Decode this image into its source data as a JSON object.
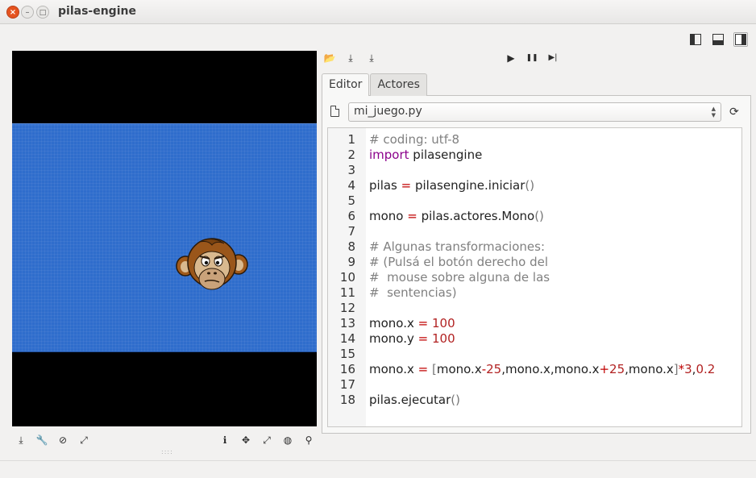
{
  "window": {
    "title": "pilas-engine",
    "close_glyph": "×",
    "min_glyph": "–",
    "max_glyph": "□"
  },
  "layout_buttons": [
    {
      "icon": "layout-left-panel-icon"
    },
    {
      "icon": "layout-bottom-panel-icon"
    },
    {
      "icon": "layout-right-panel-icon",
      "active": true
    }
  ],
  "editor_toolbar": {
    "file_actions": [
      {
        "icon": "open-folder-icon",
        "glyph": "📂"
      },
      {
        "icon": "save-icon",
        "glyph": "⤓"
      },
      {
        "icon": "save-as-icon",
        "glyph": "⤓"
      }
    ],
    "run_actions": [
      {
        "icon": "play-icon",
        "glyph": "▶"
      },
      {
        "icon": "pause-icon",
        "glyph": "❚❚"
      },
      {
        "icon": "step-icon",
        "glyph": "▶|"
      }
    ]
  },
  "tabs": [
    {
      "label": "Editor",
      "active": true
    },
    {
      "label": "Actores",
      "active": false
    }
  ],
  "file_selector": {
    "value": "mi_juego.py"
  },
  "code": {
    "lines": [
      {
        "n": "1",
        "tokens": [
          {
            "t": "# coding: utf-8",
            "c": "cm"
          }
        ]
      },
      {
        "n": "2",
        "tokens": [
          {
            "t": "import",
            "c": "kw"
          },
          {
            "t": " pilasengine",
            "c": ""
          }
        ]
      },
      {
        "n": "3",
        "tokens": []
      },
      {
        "n": "4",
        "tokens": [
          {
            "t": "pilas ",
            "c": ""
          },
          {
            "t": "=",
            "c": "op"
          },
          {
            "t": " pilasengine.iniciar",
            "c": ""
          },
          {
            "t": "()",
            "c": "br"
          }
        ]
      },
      {
        "n": "5",
        "tokens": []
      },
      {
        "n": "6",
        "tokens": [
          {
            "t": "mono ",
            "c": ""
          },
          {
            "t": "=",
            "c": "op"
          },
          {
            "t": " pilas.actores.Mono",
            "c": ""
          },
          {
            "t": "()",
            "c": "br"
          }
        ]
      },
      {
        "n": "7",
        "tokens": []
      },
      {
        "n": "8",
        "tokens": [
          {
            "t": "# Algunas transformaciones:",
            "c": "cm"
          }
        ]
      },
      {
        "n": "9",
        "tokens": [
          {
            "t": "# (Pulsá el botón derecho del",
            "c": "cm"
          }
        ]
      },
      {
        "n": "10",
        "tokens": [
          {
            "t": "#  mouse sobre alguna de las",
            "c": "cm"
          }
        ]
      },
      {
        "n": "11",
        "tokens": [
          {
            "t": "#  sentencias)",
            "c": "cm"
          }
        ]
      },
      {
        "n": "12",
        "tokens": []
      },
      {
        "n": "13",
        "tokens": [
          {
            "t": "mono.x ",
            "c": ""
          },
          {
            "t": "=",
            "c": "op"
          },
          {
            "t": " ",
            "c": ""
          },
          {
            "t": "100",
            "c": "num"
          }
        ]
      },
      {
        "n": "14",
        "tokens": [
          {
            "t": "mono.y ",
            "c": ""
          },
          {
            "t": "=",
            "c": "op"
          },
          {
            "t": " ",
            "c": ""
          },
          {
            "t": "100",
            "c": "num"
          }
        ]
      },
      {
        "n": "15",
        "tokens": []
      },
      {
        "n": "16",
        "tokens": [
          {
            "t": "mono.x ",
            "c": ""
          },
          {
            "t": "=",
            "c": "op"
          },
          {
            "t": " ",
            "c": ""
          },
          {
            "t": "[",
            "c": "br"
          },
          {
            "t": "mono.x",
            "c": ""
          },
          {
            "t": "-",
            "c": "op"
          },
          {
            "t": "25",
            "c": "num"
          },
          {
            "t": ",mono.x,mono.x",
            "c": ""
          },
          {
            "t": "+",
            "c": "op"
          },
          {
            "t": "25",
            "c": "num"
          },
          {
            "t": ",mono.x",
            "c": ""
          },
          {
            "t": "]",
            "c": "br"
          },
          {
            "t": "*",
            "c": "op"
          },
          {
            "t": "3",
            "c": "num"
          },
          {
            "t": ",",
            "c": ""
          },
          {
            "t": "0.2",
            "c": "num"
          }
        ]
      },
      {
        "n": "17",
        "tokens": []
      },
      {
        "n": "18",
        "tokens": [
          {
            "t": "pilas.ejecutar",
            "c": ""
          },
          {
            "t": "()",
            "c": "br"
          }
        ]
      }
    ]
  },
  "canvas_tools_left": [
    {
      "icon": "save-screenshot-icon",
      "glyph": "⤓"
    },
    {
      "icon": "wrench-icon",
      "glyph": "🔧"
    },
    {
      "icon": "disable-icon",
      "glyph": "⊘"
    },
    {
      "icon": "fullscreen-icon",
      "glyph": "⤢"
    }
  ],
  "canvas_tools_right": [
    {
      "icon": "info-icon",
      "glyph": "ℹ"
    },
    {
      "icon": "move-icon",
      "glyph": "✥"
    },
    {
      "icon": "expand-icon",
      "glyph": "⤢"
    },
    {
      "icon": "globe-icon",
      "glyph": "◍"
    },
    {
      "icon": "map-pin-icon",
      "glyph": "⚲"
    }
  ],
  "colors": {
    "stage_blue": "#2f6dcc",
    "keyword": "#8b008b",
    "number": "#b22222",
    "operator": "#c00000",
    "comment": "#808080"
  }
}
